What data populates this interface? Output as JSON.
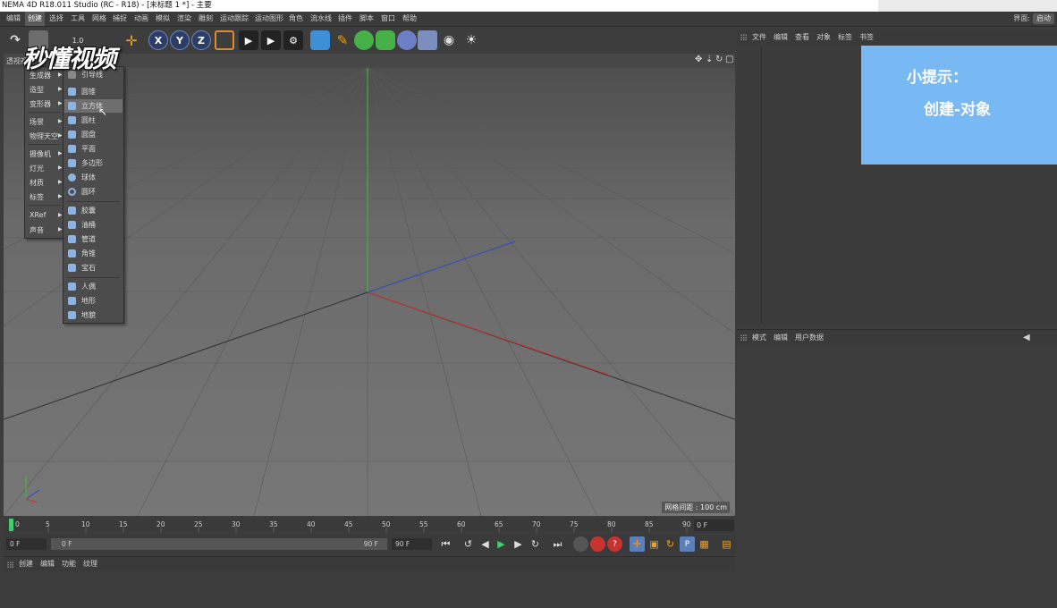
{
  "window": {
    "title": "NEMA 4D R18.011 Studio (RC - R18) - [未标题 1 *] - 主要"
  },
  "menubar": {
    "items": [
      "编辑",
      "创建",
      "选择",
      "工具",
      "网格",
      "捕捉",
      "动画",
      "模拟",
      "渲染",
      "雕刻",
      "运动跟踪",
      "运动图形",
      "角色",
      "流水线",
      "插件",
      "脚本",
      "窗口",
      "帮助"
    ],
    "active": "创建",
    "layout_label": "界面:",
    "layout_value": "启动"
  },
  "toolbar": {
    "visible_label": "1.0"
  },
  "viewport": {
    "header_label": "透视视",
    "grid_spacing": "网格间距 : 100 cm"
  },
  "create_menu": {
    "items": [
      "生成器",
      "造型",
      "变形器",
      "场景",
      "物理天空",
      "摄像机",
      "灯光",
      "材质",
      "标签",
      "XRef",
      "声音"
    ]
  },
  "object_submenu": {
    "items": [
      "引导线",
      "圆锥",
      "立方体",
      "圆柱",
      "圆盘",
      "平面",
      "多边形",
      "球体",
      "圆环",
      "胶囊",
      "油桶",
      "管道",
      "角锥",
      "宝石",
      "人偶",
      "地形",
      "地貌"
    ],
    "highlighted": "立方体"
  },
  "timeline": {
    "ticks": [
      "0",
      "5",
      "10",
      "15",
      "20",
      "25",
      "30",
      "35",
      "40",
      "45",
      "50",
      "55",
      "60",
      "65",
      "70",
      "75",
      "80",
      "85",
      "90"
    ],
    "current_frame": "0 F",
    "start_frame": "0 F",
    "range_start": "0 F",
    "range_end": "90 F",
    "end_frame": "90 F"
  },
  "material_manager": {
    "menu": [
      "创建",
      "编辑",
      "功能",
      "纹理"
    ]
  },
  "object_manager": {
    "menu": [
      "文件",
      "编辑",
      "查看",
      "对象",
      "标签",
      "书签"
    ]
  },
  "attribute_manager": {
    "menu": [
      "模式",
      "编辑",
      "用户数据"
    ]
  },
  "tip": {
    "title": "小提示：",
    "body": "创建-对象"
  },
  "watermark": {
    "text": "秒懂视频"
  },
  "colors": {
    "tip_background": "#78b9f4",
    "axis_x": "#c83232",
    "axis_y": "#3cbe3c",
    "axis_z": "#3246c8"
  }
}
